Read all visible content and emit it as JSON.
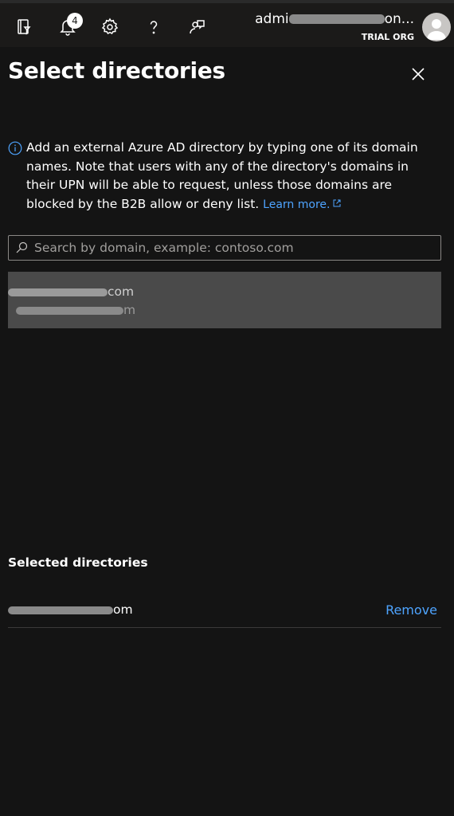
{
  "topbar": {
    "icons": [
      "directory-filter-icon",
      "bell-icon",
      "gear-icon",
      "help-icon",
      "feedback-icon"
    ],
    "notification_count": "4",
    "account_name_start": "admi",
    "account_name_end": "on...",
    "account_org": "TRIAL ORG"
  },
  "panel": {
    "title": "Select directories",
    "info_text": "Add an external Azure AD directory by typing one of its domain names. Note that users with any of the directory's domains in their UPN will be able to request, unless those domains are blocked by the B2B allow or deny list.",
    "learn_more": "Learn more.",
    "search_placeholder": "Search by domain, example: contoso.com",
    "result_line1_suffix": "com",
    "result_line2_suffix": "m",
    "selected_heading": "Selected directories",
    "selected_domain_suffix": "om",
    "remove_label": "Remove"
  },
  "colors": {
    "background": "#141414",
    "topbar": "#1b1a19",
    "accent_link": "#4ea4ff",
    "result_highlight": "#4a4a4a"
  }
}
